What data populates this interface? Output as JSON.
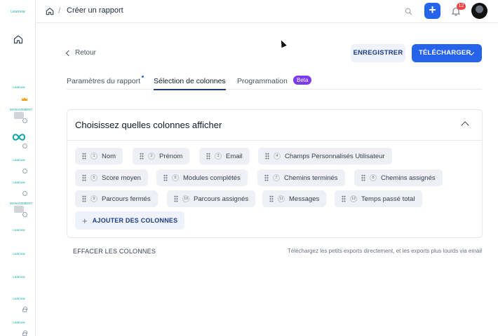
{
  "header": {
    "breadcrumb_sep": "/",
    "title": "Créer un rapport",
    "notification_count": "12",
    "accent": "#2563eb"
  },
  "sidebar": {
    "brand": "Learnow",
    "items": [
      {
        "label": "Learnow",
        "badge": "crown"
      },
      {
        "label": "MANAGEMENT",
        "badge": "clock"
      },
      {
        "label": "",
        "badge": "clock"
      },
      {
        "label": "Learnow",
        "badge": "clock"
      },
      {
        "label": "Learnow",
        "badge": "clock"
      },
      {
        "label": "MANAGEMENT",
        "badge": "clock"
      },
      {
        "label": "Learnow",
        "badge": ""
      },
      {
        "label": "Learnow",
        "badge": ""
      },
      {
        "label": "Learnow",
        "badge": ""
      },
      {
        "label": "Learnow",
        "badge": "lock"
      },
      {
        "label": "Learnow",
        "badge": "lock"
      }
    ]
  },
  "actions": {
    "back": "Retour",
    "save": "ENREGISTRER",
    "download": "TÉLÉCHARGER"
  },
  "tabs": [
    {
      "label": "Paramètres du rapport"
    },
    {
      "label": "Sélection de colonnes"
    },
    {
      "label": "Programmation"
    }
  ],
  "tab_badge": "Beta",
  "card": {
    "title": "Choisissez quelles colonnes afficher",
    "columns": [
      {
        "n": "1",
        "label": "Nom"
      },
      {
        "n": "2",
        "label": "Prénom"
      },
      {
        "n": "3",
        "label": "Email"
      },
      {
        "n": "4",
        "label": "Champs Personnalisés Utilisateur"
      },
      {
        "n": "5",
        "label": "Score moyen"
      },
      {
        "n": "6",
        "label": "Modules complétés"
      },
      {
        "n": "7",
        "label": "Chemins terminés"
      },
      {
        "n": "8",
        "label": "Chemins assignés"
      },
      {
        "n": "9",
        "label": "Parcours fermés"
      },
      {
        "n": "10",
        "label": "Parcours assignés"
      },
      {
        "n": "11",
        "label": "Messages"
      },
      {
        "n": "12",
        "label": "Temps passé total"
      }
    ],
    "add_label": "AJOUTER DES COLONNES"
  },
  "footer": {
    "clear": "EFFACER LES COLONNES",
    "hint": "Téléchargez les petits exports directement, et les exports plus lourds via email"
  }
}
